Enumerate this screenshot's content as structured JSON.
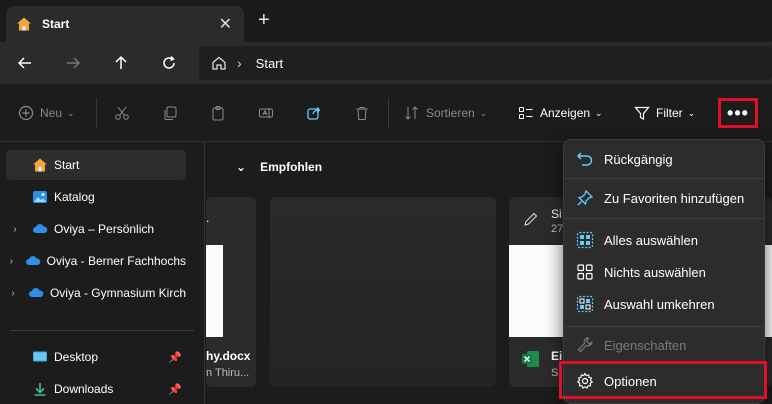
{
  "tab": {
    "title": "Start",
    "close": "✕",
    "new_tab": "+"
  },
  "address": {
    "crumb": "Start",
    "sep": "›"
  },
  "commands": {
    "new": "Neu",
    "sort": "Sortieren",
    "view": "Anzeigen",
    "filter": "Filter",
    "more": "•••"
  },
  "sidebar": {
    "items": [
      {
        "label": "Start"
      },
      {
        "label": "Katalog"
      },
      {
        "label": "Oviya – Persönlich"
      },
      {
        "label": "Oviya - Berner Fachhochs"
      },
      {
        "label": "Oviya - Gymnasium Kirch"
      },
      {
        "label": "Desktop"
      },
      {
        "label": "Downloads"
      }
    ]
  },
  "main": {
    "section": "Empfohlen",
    "cards": [
      {
        "name": "hy.docx",
        "sub": "n Thiru..."
      },
      {
        "name": "",
        "sub": ""
      },
      {
        "name": "Si",
        "sub": "27",
        "name2": "Ei",
        "sub2": "S"
      }
    ]
  },
  "menu": {
    "undo": "Rückgängig",
    "add_fav": "Zu Favoriten hinzufügen",
    "select_all": "Alles auswählen",
    "select_none": "Nichts auswählen",
    "invert": "Auswahl umkehren",
    "properties": "Eigenschaften",
    "options": "Optionen"
  },
  "colors": {
    "accent": "#60cdff",
    "highlight": "#e0102a",
    "home": "#f2a33a"
  }
}
